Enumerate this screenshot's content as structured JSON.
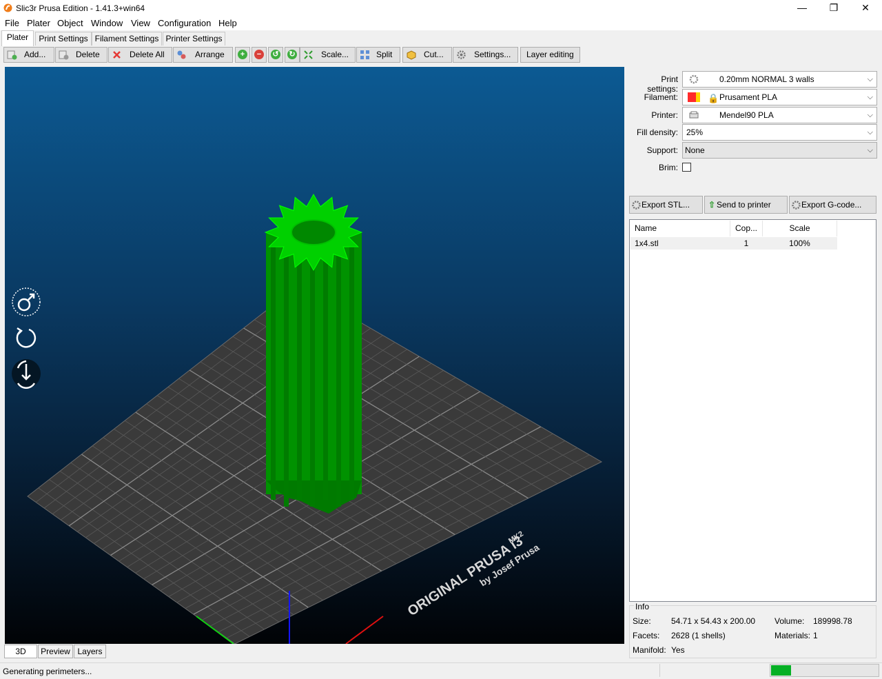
{
  "window": {
    "title": "Slic3r Prusa Edition - 1.41.3+win64",
    "minimize": "—",
    "maximize": "❐",
    "close": "✕"
  },
  "menu": [
    "File",
    "Plater",
    "Object",
    "Window",
    "View",
    "Configuration",
    "Help"
  ],
  "tabs": [
    "Plater",
    "Print Settings",
    "Filament Settings",
    "Printer Settings"
  ],
  "toolbar": {
    "add": "Add...",
    "delete": "Delete",
    "delete_all": "Delete All",
    "arrange": "Arrange",
    "scale": "Scale...",
    "split": "Split",
    "cut": "Cut...",
    "settings": "Settings...",
    "layer_editing": "Layer editing"
  },
  "bed": {
    "brand_line1": "ORIGINAL PRUSA i3",
    "brand_mk": "MK2",
    "brand_line2": "by Josef Prusa"
  },
  "view_tabs": [
    "3D",
    "Preview",
    "Layers"
  ],
  "settings_panel": {
    "print_label": "Print settings:",
    "print_value": "0.20mm NORMAL 3 walls",
    "filament_label": "Filament:",
    "filament_value": "Prusament PLA",
    "filament_colors": [
      "#ff2a2a",
      "#ffd400"
    ],
    "printer_label": "Printer:",
    "printer_value": "Mendel90 PLA",
    "fill_label": "Fill density:",
    "fill_value": "25%",
    "support_label": "Support:",
    "support_value": "None",
    "brim_label": "Brim:",
    "brim_checked": false
  },
  "export": {
    "stl": "Export STL...",
    "send": "Send to printer",
    "gcode": "Export G-code..."
  },
  "object_list": {
    "headers": [
      "Name",
      "Cop...",
      "Scale"
    ],
    "rows": [
      {
        "name": "1x4.stl",
        "copies": "1",
        "scale": "100%"
      }
    ]
  },
  "info": {
    "title": "Info",
    "size_label": "Size:",
    "size_value": "54.71 x 54.43 x 200.00",
    "volume_label": "Volume:",
    "volume_value": "189998.78",
    "facets_label": "Facets:",
    "facets_value": "2628 (1 shells)",
    "materials_label": "Materials:",
    "materials_value": "1",
    "manifold_label": "Manifold:",
    "manifold_value": "Yes"
  },
  "status": {
    "text": "Generating perimeters...",
    "progress": 0.19
  },
  "colors": {
    "model_green": "#00a000",
    "progress_green": "#06b025"
  }
}
